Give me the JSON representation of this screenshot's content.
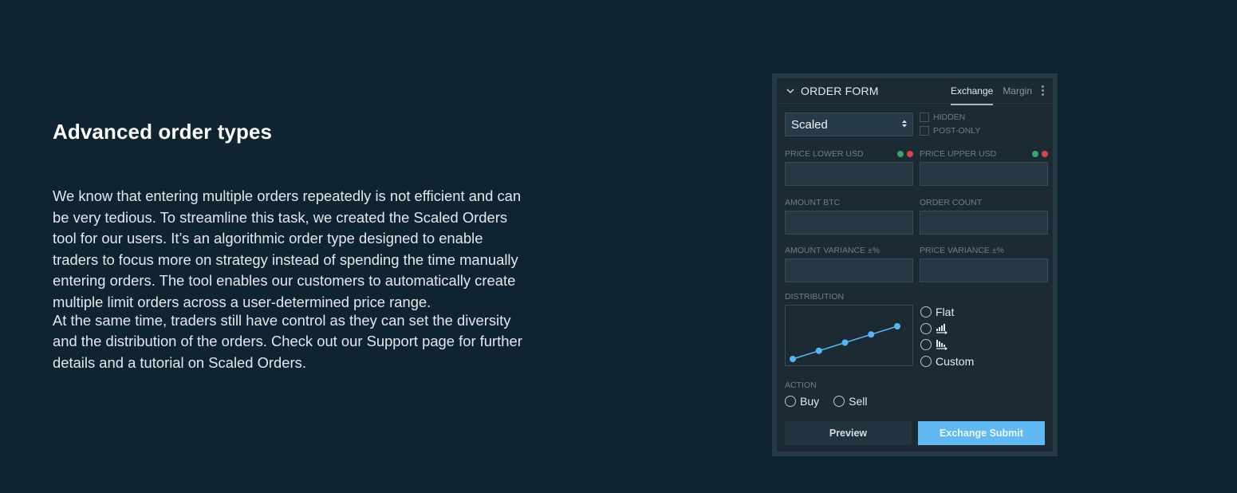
{
  "intro": {
    "heading": "Advanced order types",
    "paragraph1": "We know that entering multiple orders repeatedly is not efficient and can be very tedious. To streamline this task, we created the Scaled Orders tool for our users. It’s an algorithmic order type designed to enable traders to focus more on strategy instead of spending the time manually entering orders. The tool enables our customers to automatically create multiple limit orders across a user-determined price range.",
    "paragraph2": "At the same time, traders still have control as they can set the diversity and the distribution of the orders. Check out our Support page for further details and a tutorial on Scaled Orders."
  },
  "order_form": {
    "title": "ORDER FORM",
    "tabs": [
      {
        "label": "Exchange",
        "active": true
      },
      {
        "label": "Margin",
        "active": false
      }
    ],
    "order_type": {
      "selected": "Scaled"
    },
    "checkboxes": [
      {
        "label": "HIDDEN",
        "checked": false
      },
      {
        "label": "POST-ONLY",
        "checked": false
      }
    ],
    "fields": {
      "price_lower": {
        "label": "PRICE LOWER USD",
        "value": ""
      },
      "price_upper": {
        "label": "PRICE UPPER USD",
        "value": ""
      },
      "amount": {
        "label": "AMOUNT BTC",
        "value": ""
      },
      "order_count": {
        "label": "ORDER COUNT",
        "value": ""
      },
      "amount_variance": {
        "label": "AMOUNT VARIANCE ±%",
        "value": ""
      },
      "price_variance": {
        "label": "PRICE VARIANCE ±%",
        "value": ""
      }
    },
    "status_colors": {
      "green": "#3aa572",
      "red": "#d6434b"
    },
    "distribution": {
      "label": "DISTRIBUTION",
      "preview_points": [
        0,
        0.25,
        0.5,
        0.75,
        1
      ],
      "line_color": "#5ab4f0",
      "options": [
        {
          "label": "Flat",
          "icon": null,
          "selected": false
        },
        {
          "label": "",
          "icon": "increasing-bars-icon",
          "selected": false
        },
        {
          "label": "",
          "icon": "decreasing-bars-icon",
          "selected": false
        },
        {
          "label": "Custom",
          "icon": null,
          "selected": false
        }
      ]
    },
    "action": {
      "label": "ACTION",
      "options": [
        {
          "label": "Buy",
          "selected": false
        },
        {
          "label": "Sell",
          "selected": false
        }
      ]
    },
    "buttons": {
      "preview": "Preview",
      "submit": "Exchange Submit"
    },
    "accent_color": "#62b9f2"
  }
}
